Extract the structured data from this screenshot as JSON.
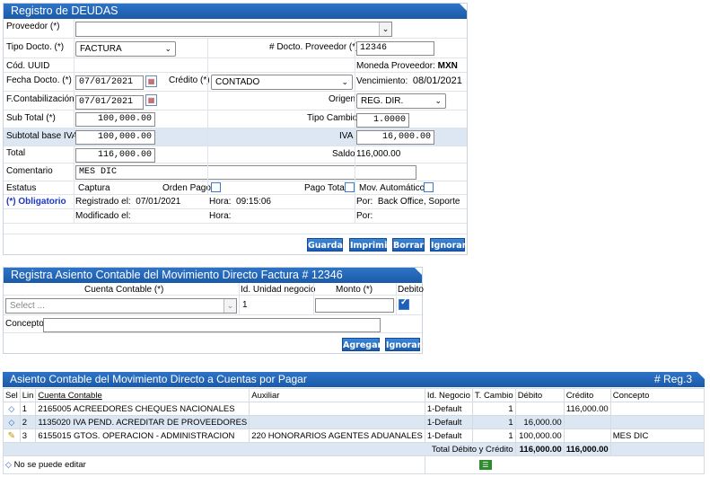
{
  "deudas": {
    "title": "Registro de DEUDAS",
    "proveedor_label": "Proveedor (*)",
    "proveedor_value": "",
    "tipo_docto_label": "Tipo Docto. (*)",
    "tipo_docto_value": "FACTURA",
    "num_docto_label": "# Docto. Proveedor (*)",
    "num_docto_value": "12346",
    "cod_uuid_label": "Cód. UUID",
    "moneda_label": "Moneda Proveedor:",
    "moneda_value": "MXN",
    "fecha_label": "Fecha Docto. (*)",
    "fecha_value": "07/01/2021",
    "credito_label": "Crédito (*)",
    "credito_value": "CONTADO",
    "venc_label": "Vencimiento:",
    "venc_value": "08/01/2021",
    "fcont_label": "F.Contabilización",
    "fcont_value": "07/01/2021",
    "origen_label": "Origen",
    "origen_value": "REG. DIR.",
    "subtotal_label": "Sub Total (*)",
    "subtotal_value": "100,000.00",
    "tipocambio_label": "Tipo Cambio",
    "tipocambio_value": "1.0000",
    "subtotal_iva_label": "Subtotal base IVA",
    "subtotal_iva_value": "100,000.00",
    "iva_label": "IVA",
    "iva_value": "16,000.00",
    "total_label": "Total",
    "total_value": "116,000.00",
    "saldo_label": "Saldo",
    "saldo_value": "116,000.00",
    "comentario_label": "Comentario",
    "comentario_value": "MES DIC",
    "estatus_label": "Estatus",
    "estatus_value": "Captura",
    "orden_pago_label": "Orden Pago",
    "pago_total_label": "Pago Total",
    "mov_auto_label": "Mov. Automático",
    "obligatorio": "(*) Obligatorio",
    "registrado_label": "Registrado el:",
    "registrado_value": "07/01/2021",
    "hora_label": "Hora:",
    "hora_value": "09:15:06",
    "por_label": "Por:",
    "por_value": "Back Office, Soporte",
    "modificado_label": "Modificado el:",
    "hora2_label": "Hora:",
    "por2_label": "Por:",
    "buttons": {
      "guardar": "Guardar",
      "imprimir": "Imprimir",
      "borrar": "Borrar",
      "ignorar": "Ignorar"
    }
  },
  "asiento": {
    "title": "Registra Asiento Contable del Movimiento Directo Factura # 12346",
    "col_cuenta": "Cuenta Contable (*)",
    "col_unidad": "Id. Unidad negocio",
    "col_monto": "Monto (*)",
    "col_debito": "Debito",
    "cuenta_placeholder": "Select ...",
    "unidad_value": "1",
    "monto_value": "",
    "concepto_label": "Concepto",
    "concepto_value": "",
    "buttons": {
      "agregar": "Agregar",
      "ignorar": "Ignorar"
    }
  },
  "movs": {
    "title": "Asiento Contable del Movimiento Directo a Cuentas por Pagar",
    "reg_count": "# Reg.3",
    "headers": {
      "sel": "Sel",
      "lin": "Lin",
      "cuenta": "Cuenta Contable",
      "auxiliar": "Auxiliar",
      "negocio": "Id. Negocio",
      "tcambio": "T. Cambio",
      "debito": "Débito",
      "credito": "Crédito",
      "concepto": "Concepto"
    },
    "rows": [
      {
        "sel": "diamond-icon",
        "lin": "1",
        "cuenta": "2165005 ACREEDORES CHEQUES NACIONALES",
        "auxiliar": "",
        "negocio": "1-Default",
        "tcambio": "1",
        "debito": "",
        "credito": "116,000.00",
        "concepto": ""
      },
      {
        "sel": "diamond-icon",
        "lin": "2",
        "cuenta": "1135020 IVA PEND. ACREDITAR DE PROVEEDORES",
        "auxiliar": "",
        "negocio": "1-Default",
        "tcambio": "1",
        "debito": "16,000.00",
        "credito": "",
        "concepto": ""
      },
      {
        "sel": "pencil-icon",
        "lin": "3",
        "cuenta": "6155015 GTOS. OPERACION - ADMINISTRACION",
        "auxiliar": "220 HONORARIOS AGENTES ADUANALES",
        "negocio": "1-Default",
        "tcambio": "1",
        "debito": "100,000.00",
        "credito": "",
        "concepto": "MES DIC"
      }
    ],
    "total_label": "Total Débito y Crédito",
    "total_debito": "116,000.00",
    "total_credito": "116,000.00",
    "footer_note": "No se puede editar"
  },
  "colors": {
    "header": "#1f62b5",
    "shade": "#dce7f3",
    "required": "#1d35c9"
  }
}
